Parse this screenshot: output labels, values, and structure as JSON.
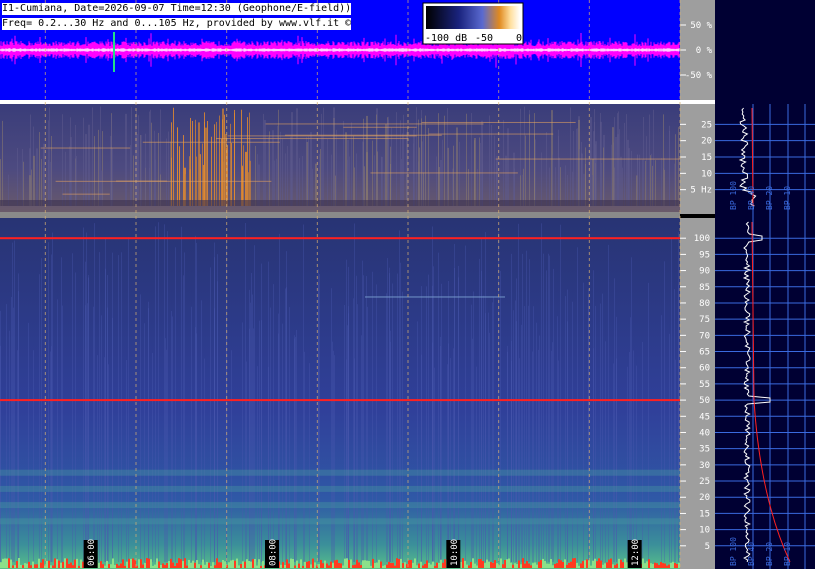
{
  "header": {
    "line1": "I1-Cumiana, Date=2026-09-07 Time=12:30 (Geophone/E-field))",
    "line2": "Freq= 0.2...30 Hz and 0...105 Hz, provided by www.vlf.it ©"
  },
  "colors": {
    "waveform_bg": "#0000ff",
    "waveform_trace": "#ff00ff",
    "spectrogram_bg": "#202a78",
    "right_panel_bg": "#000033",
    "line_red": "#ff2020",
    "grid_blue": "#3a6adf"
  },
  "chart_data": [
    {
      "type": "line",
      "name": "waveform",
      "ylabel_ticks": [
        "50 %",
        "0 %",
        "-50 %"
      ],
      "ylim": [
        -100,
        100
      ]
    },
    {
      "type": "heatmap",
      "name": "spectrogram-low",
      "ylim": [
        0,
        30
      ],
      "y_ticks": [
        {
          "value": 25,
          "label": "25"
        },
        {
          "value": 20,
          "label": "20"
        },
        {
          "value": 15,
          "label": "15"
        },
        {
          "value": 10,
          "label": "10"
        },
        {
          "value": 5,
          "label": "5 Hz"
        }
      ]
    },
    {
      "type": "heatmap",
      "name": "spectrogram-high",
      "ylim": [
        0,
        105
      ],
      "y_ticks": [
        100,
        95,
        90,
        85,
        80,
        75,
        70,
        65,
        60,
        55,
        50,
        45,
        40,
        35,
        30,
        25,
        20,
        15,
        10,
        5
      ],
      "x_time_ticks": [
        "06:00",
        "08:00",
        "10:00",
        "12:00"
      ],
      "x_time_range_hours": [
        5.0,
        12.5
      ]
    }
  ],
  "colorbar": {
    "labels": [
      "-100 dB",
      "-50",
      "0"
    ],
    "range_db": [
      -100,
      0
    ]
  },
  "right_panel": {
    "upper_labels": [
      "BP 100",
      "BP 40",
      "BP 20",
      "BP 10"
    ],
    "lower_labels": [
      "BP 100",
      "BP 40",
      "BP 20",
      "BP 10"
    ]
  }
}
